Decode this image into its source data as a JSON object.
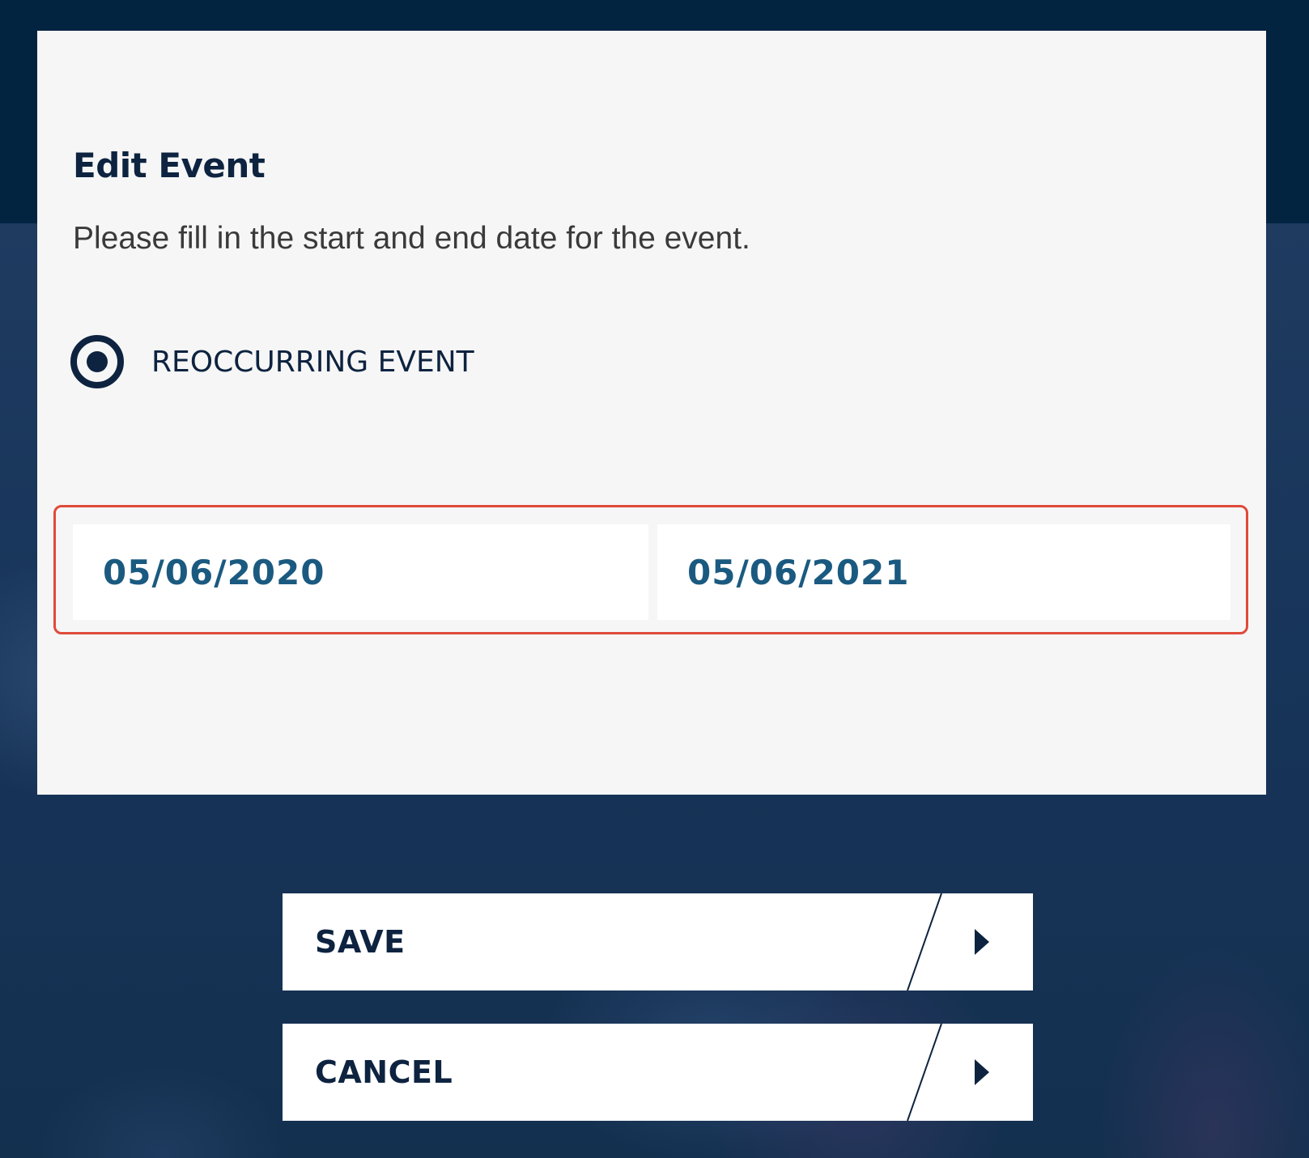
{
  "dialog": {
    "title": "Edit Event",
    "subtitle": "Please fill in the start and end date for the event.",
    "reoccurring": {
      "label": "REOCCURRING EVENT",
      "selected": true
    },
    "dates": {
      "start": "05/06/2020",
      "end": "05/06/2021"
    }
  },
  "actions": {
    "save_label": "SAVE",
    "cancel_label": "CANCEL"
  },
  "colors": {
    "navy": "#0d2340",
    "date_text": "#1b5a80",
    "highlight_border": "#e04a3a",
    "dialog_bg": "#f6f6f6"
  },
  "icons": {
    "radio": "radio-selected-icon",
    "button_arrow": "chevron-right-icon"
  }
}
